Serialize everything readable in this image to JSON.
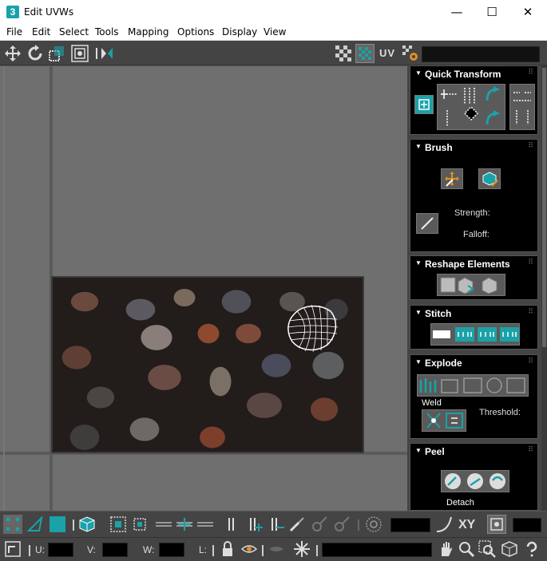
{
  "window": {
    "app_icon": "3",
    "title": "Edit UVWs",
    "minimize": "—",
    "maximize": "☐",
    "close": "✕"
  },
  "menu": [
    "File",
    "Edit",
    "Select",
    "Tools",
    "Mapping",
    "Options",
    "Display",
    "View"
  ],
  "toolbar": {
    "uv_label": "UV"
  },
  "panels": {
    "quick_transform": {
      "title": "Quick Transform"
    },
    "brush": {
      "title": "Brush",
      "strength_label": "Strength:",
      "falloff_label": "Falloff:"
    },
    "reshape": {
      "title": "Reshape Elements"
    },
    "stitch": {
      "title": "Stitch"
    },
    "explode": {
      "title": "Explode",
      "weld_label": "Weld",
      "threshold_label": "Threshold:"
    },
    "peel": {
      "title": "Peel",
      "detach_label": "Detach"
    }
  },
  "bottom": {
    "xy_label": "XY",
    "u_label": "U:",
    "v_label": "V:",
    "w_label": "W:",
    "l_label": "L:"
  },
  "colors": {
    "accent": "#1ba1a8",
    "panel_bg": "#000000",
    "ui_bg": "#444444",
    "viewport_bg": "#6f6f6f"
  },
  "icons": [
    "move-icon",
    "rotate-icon",
    "scale-icon",
    "freeform-icon",
    "mirror-icon",
    "checker-icon",
    "texture-checker-icon",
    "settings-icon"
  ]
}
